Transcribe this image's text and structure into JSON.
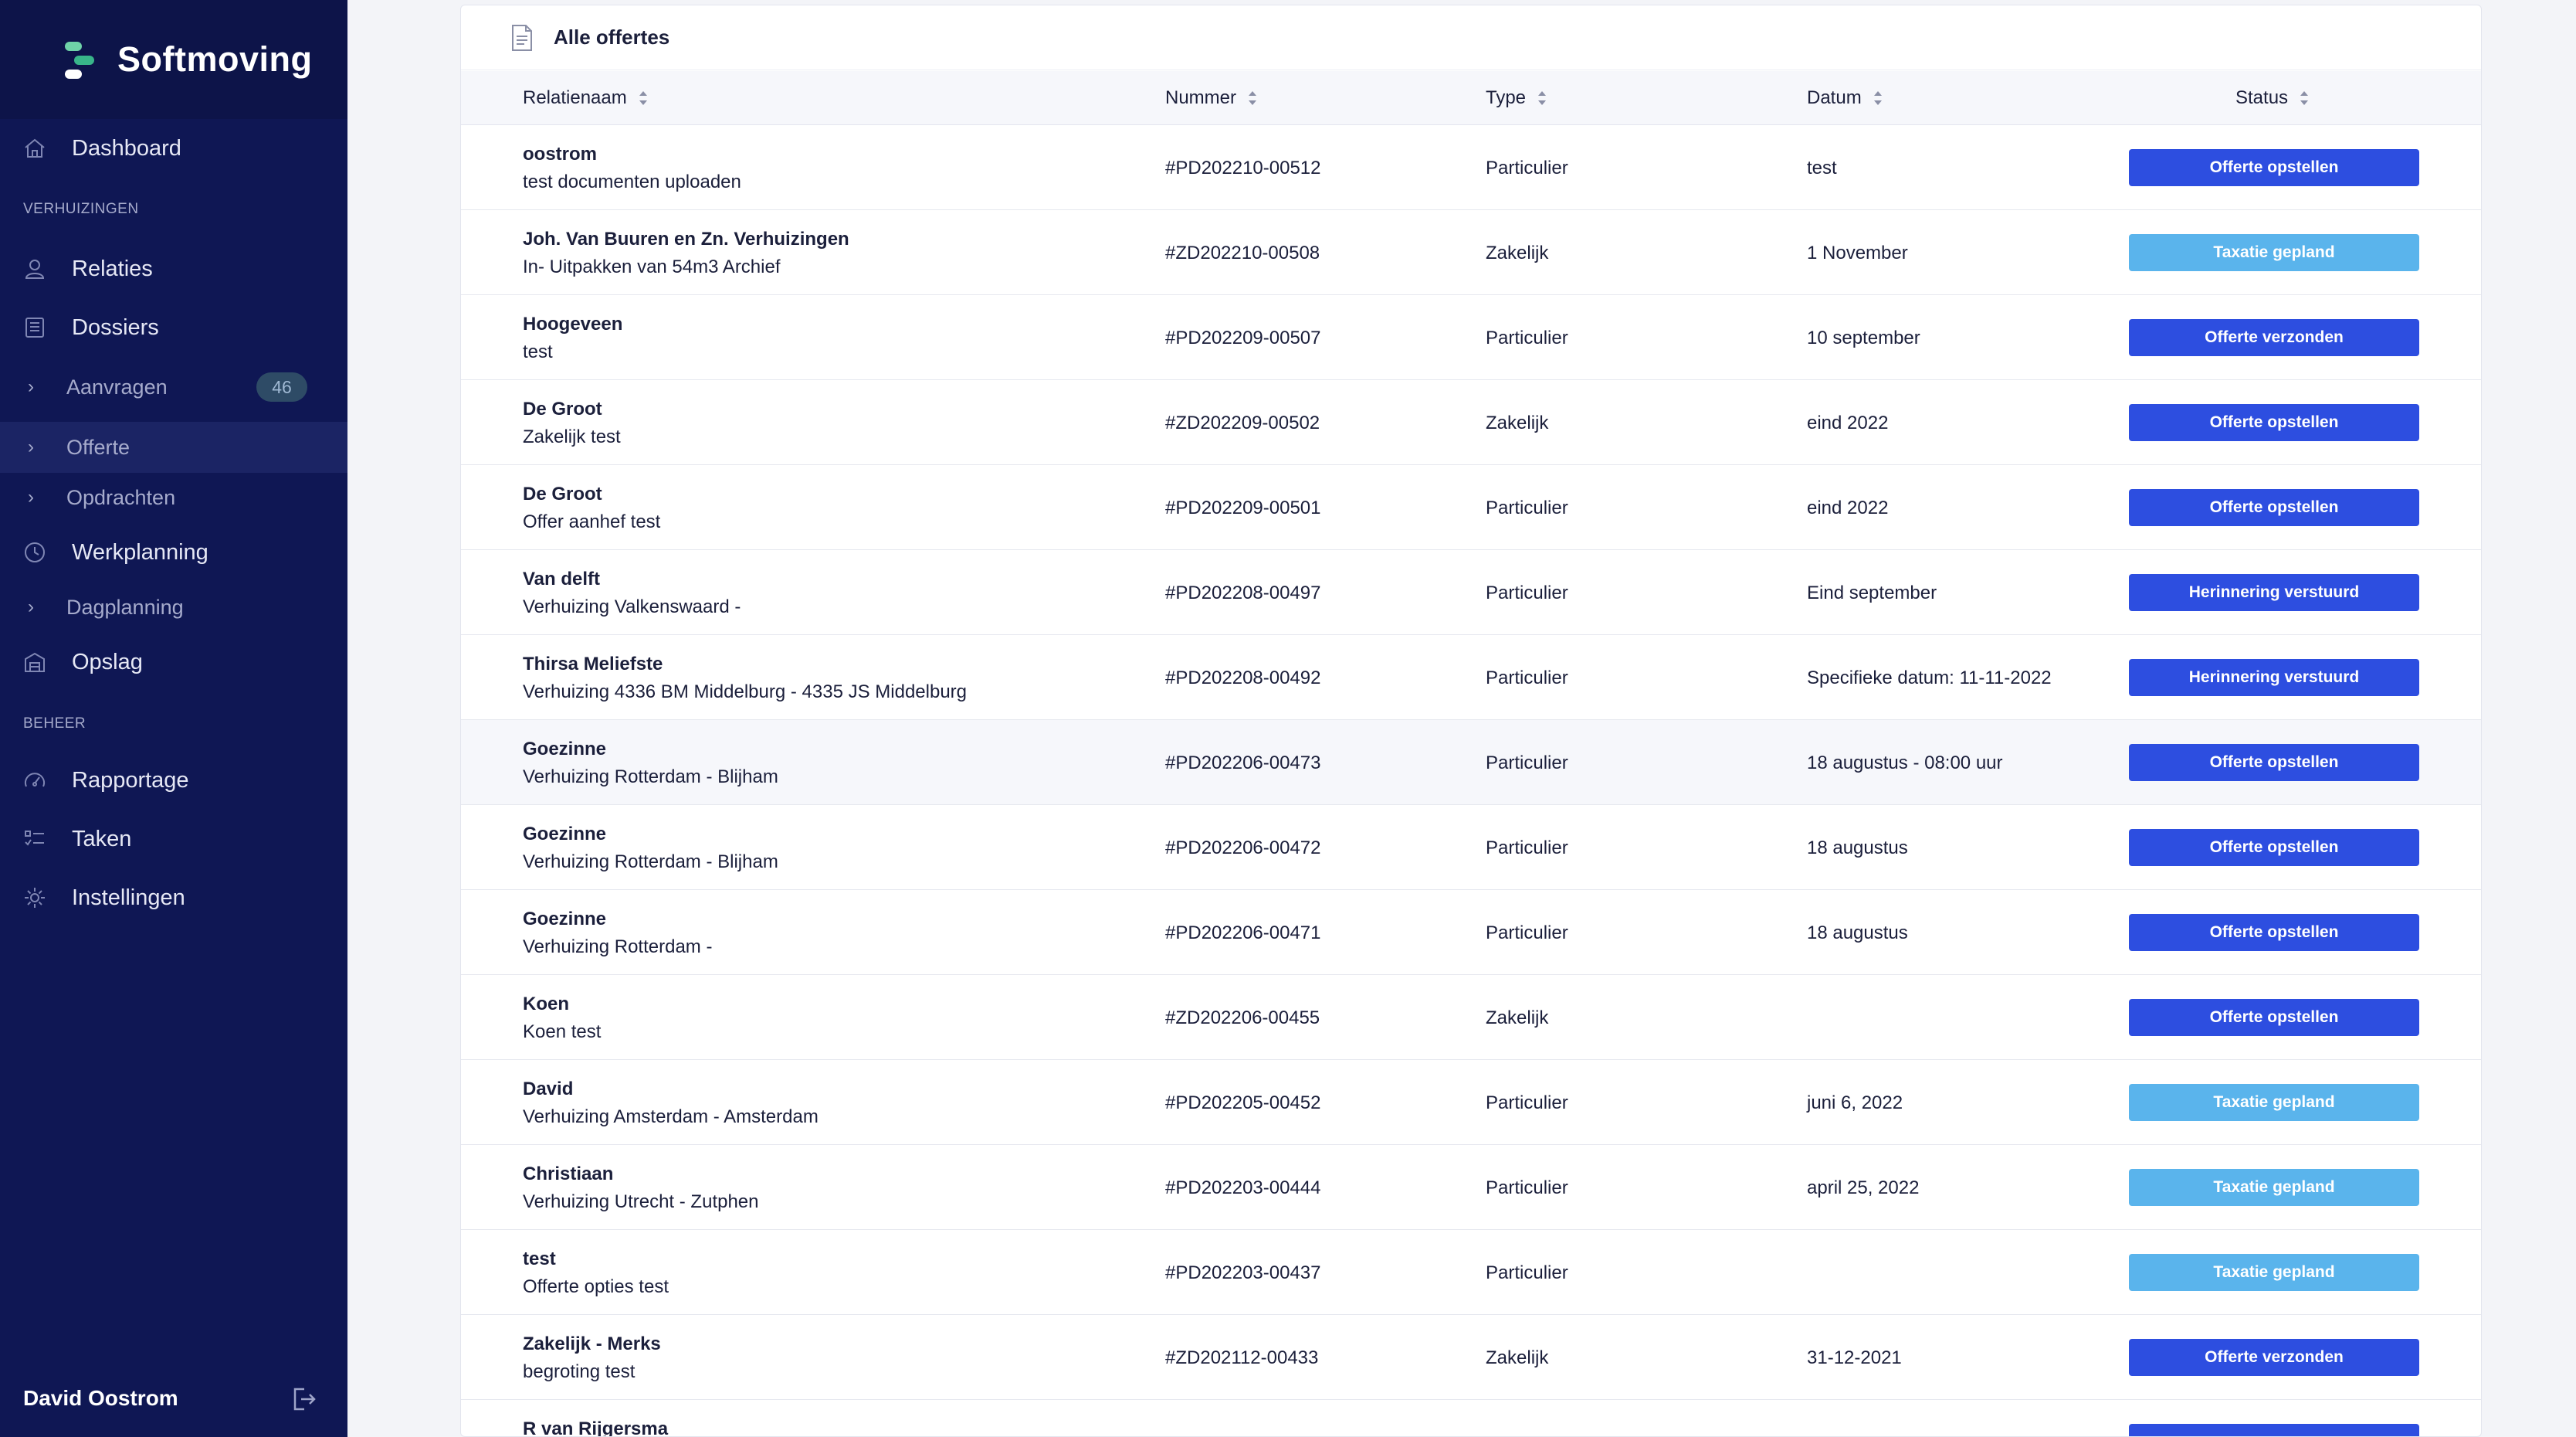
{
  "brand": {
    "name": "Softmoving"
  },
  "sidebar": {
    "items": [
      {
        "label": "Dashboard",
        "icon": "home-icon"
      },
      {
        "label": "Relaties",
        "icon": "user-icon"
      },
      {
        "label": "Dossiers",
        "icon": "folder-icon"
      },
      {
        "label": "Aanvragen",
        "badge": "46"
      },
      {
        "label": "Offerte"
      },
      {
        "label": "Opdrachten"
      },
      {
        "label": "Werkplanning",
        "icon": "clock-icon"
      },
      {
        "label": "Dagplanning"
      },
      {
        "label": "Opslag",
        "icon": "warehouse-icon"
      },
      {
        "label": "Rapportage",
        "icon": "gauge-icon"
      },
      {
        "label": "Taken",
        "icon": "checklist-icon"
      },
      {
        "label": "Instellingen",
        "icon": "gear-icon"
      }
    ],
    "sections": {
      "verhuizingen": "VERHUIZINGEN",
      "beheer": "BEHEER"
    },
    "user": {
      "name": "David Oostrom"
    }
  },
  "main": {
    "title": "Alle offertes",
    "columns": {
      "relatienaam": "Relatienaam",
      "nummer": "Nummer",
      "type": "Type",
      "datum": "Datum",
      "status": "Status"
    },
    "rows": [
      {
        "name": "oostrom",
        "desc": "test documenten uploaden",
        "number": "#PD202210-00512",
        "type": "Particulier",
        "date": "test",
        "status": "Offerte opstellen",
        "kind": "primary"
      },
      {
        "name": "Joh. Van Buuren en Zn. Verhuizingen",
        "desc": "In- Uitpakken van 54m3 Archief",
        "number": "#ZD202210-00508",
        "type": "Zakelijk",
        "date": "1 November",
        "status": "Taxatie gepland",
        "kind": "light"
      },
      {
        "name": "Hoogeveen",
        "desc": "test",
        "number": "#PD202209-00507",
        "type": "Particulier",
        "date": "10 september",
        "status": "Offerte verzonden",
        "kind": "primary"
      },
      {
        "name": "De Groot",
        "desc": "Zakelijk test",
        "number": "#ZD202209-00502",
        "type": "Zakelijk",
        "date": "eind 2022",
        "status": "Offerte opstellen",
        "kind": "primary"
      },
      {
        "name": "De Groot",
        "desc": "Offer aanhef test",
        "number": "#PD202209-00501",
        "type": "Particulier",
        "date": "eind 2022",
        "status": "Offerte opstellen",
        "kind": "primary"
      },
      {
        "name": "Van delft",
        "desc": "Verhuizing Valkenswaard -",
        "number": "#PD202208-00497",
        "type": "Particulier",
        "date": "Eind september",
        "status": "Herinnering verstuurd",
        "kind": "primary"
      },
      {
        "name": "Thirsa Meliefste",
        "desc": "Verhuizing 4336 BM Middelburg - 4335 JS Middelburg",
        "number": "#PD202208-00492",
        "type": "Particulier",
        "date": "Specifieke datum: 11-11-2022",
        "status": "Herinnering verstuurd",
        "kind": "primary"
      },
      {
        "name": "Goezinne",
        "desc": "Verhuizing Rotterdam - Blijham",
        "number": "#PD202206-00473",
        "type": "Particulier",
        "date": "18 augustus - 08:00 uur",
        "status": "Offerte opstellen",
        "kind": "primary",
        "highlight": true
      },
      {
        "name": "Goezinne",
        "desc": "Verhuizing Rotterdam - Blijham",
        "number": "#PD202206-00472",
        "type": "Particulier",
        "date": "18 augustus",
        "status": "Offerte opstellen",
        "kind": "primary"
      },
      {
        "name": "Goezinne",
        "desc": "Verhuizing Rotterdam -",
        "number": "#PD202206-00471",
        "type": "Particulier",
        "date": "18 augustus",
        "status": "Offerte opstellen",
        "kind": "primary"
      },
      {
        "name": "Koen",
        "desc": "Koen test",
        "number": "#ZD202206-00455",
        "type": "Zakelijk",
        "date": "",
        "status": "Offerte opstellen",
        "kind": "primary"
      },
      {
        "name": "David",
        "desc": "Verhuizing Amsterdam - Amsterdam",
        "number": "#PD202205-00452",
        "type": "Particulier",
        "date": "juni 6, 2022",
        "status": "Taxatie gepland",
        "kind": "light"
      },
      {
        "name": "Christiaan",
        "desc": "Verhuizing Utrecht - Zutphen",
        "number": "#PD202203-00444",
        "type": "Particulier",
        "date": "april 25, 2022",
        "status": "Taxatie gepland",
        "kind": "light"
      },
      {
        "name": "test",
        "desc": "Offerte opties test",
        "number": "#PD202203-00437",
        "type": "Particulier",
        "date": "",
        "status": "Taxatie gepland",
        "kind": "light"
      },
      {
        "name": "Zakelijk - Merks",
        "desc": "begroting test",
        "number": "#ZD202112-00433",
        "type": "Zakelijk",
        "date": "31-12-2021",
        "status": "Offerte verzonden",
        "kind": "primary"
      },
      {
        "name": "R van Rijgersma",
        "desc": "",
        "number": "",
        "type": "",
        "date": "",
        "status": "",
        "kind": "primary"
      }
    ]
  },
  "colors": {
    "sidebar": "#0f1754",
    "primary": "#2d4ee0",
    "light": "#5ab4ec",
    "accent": "#39b58a"
  }
}
